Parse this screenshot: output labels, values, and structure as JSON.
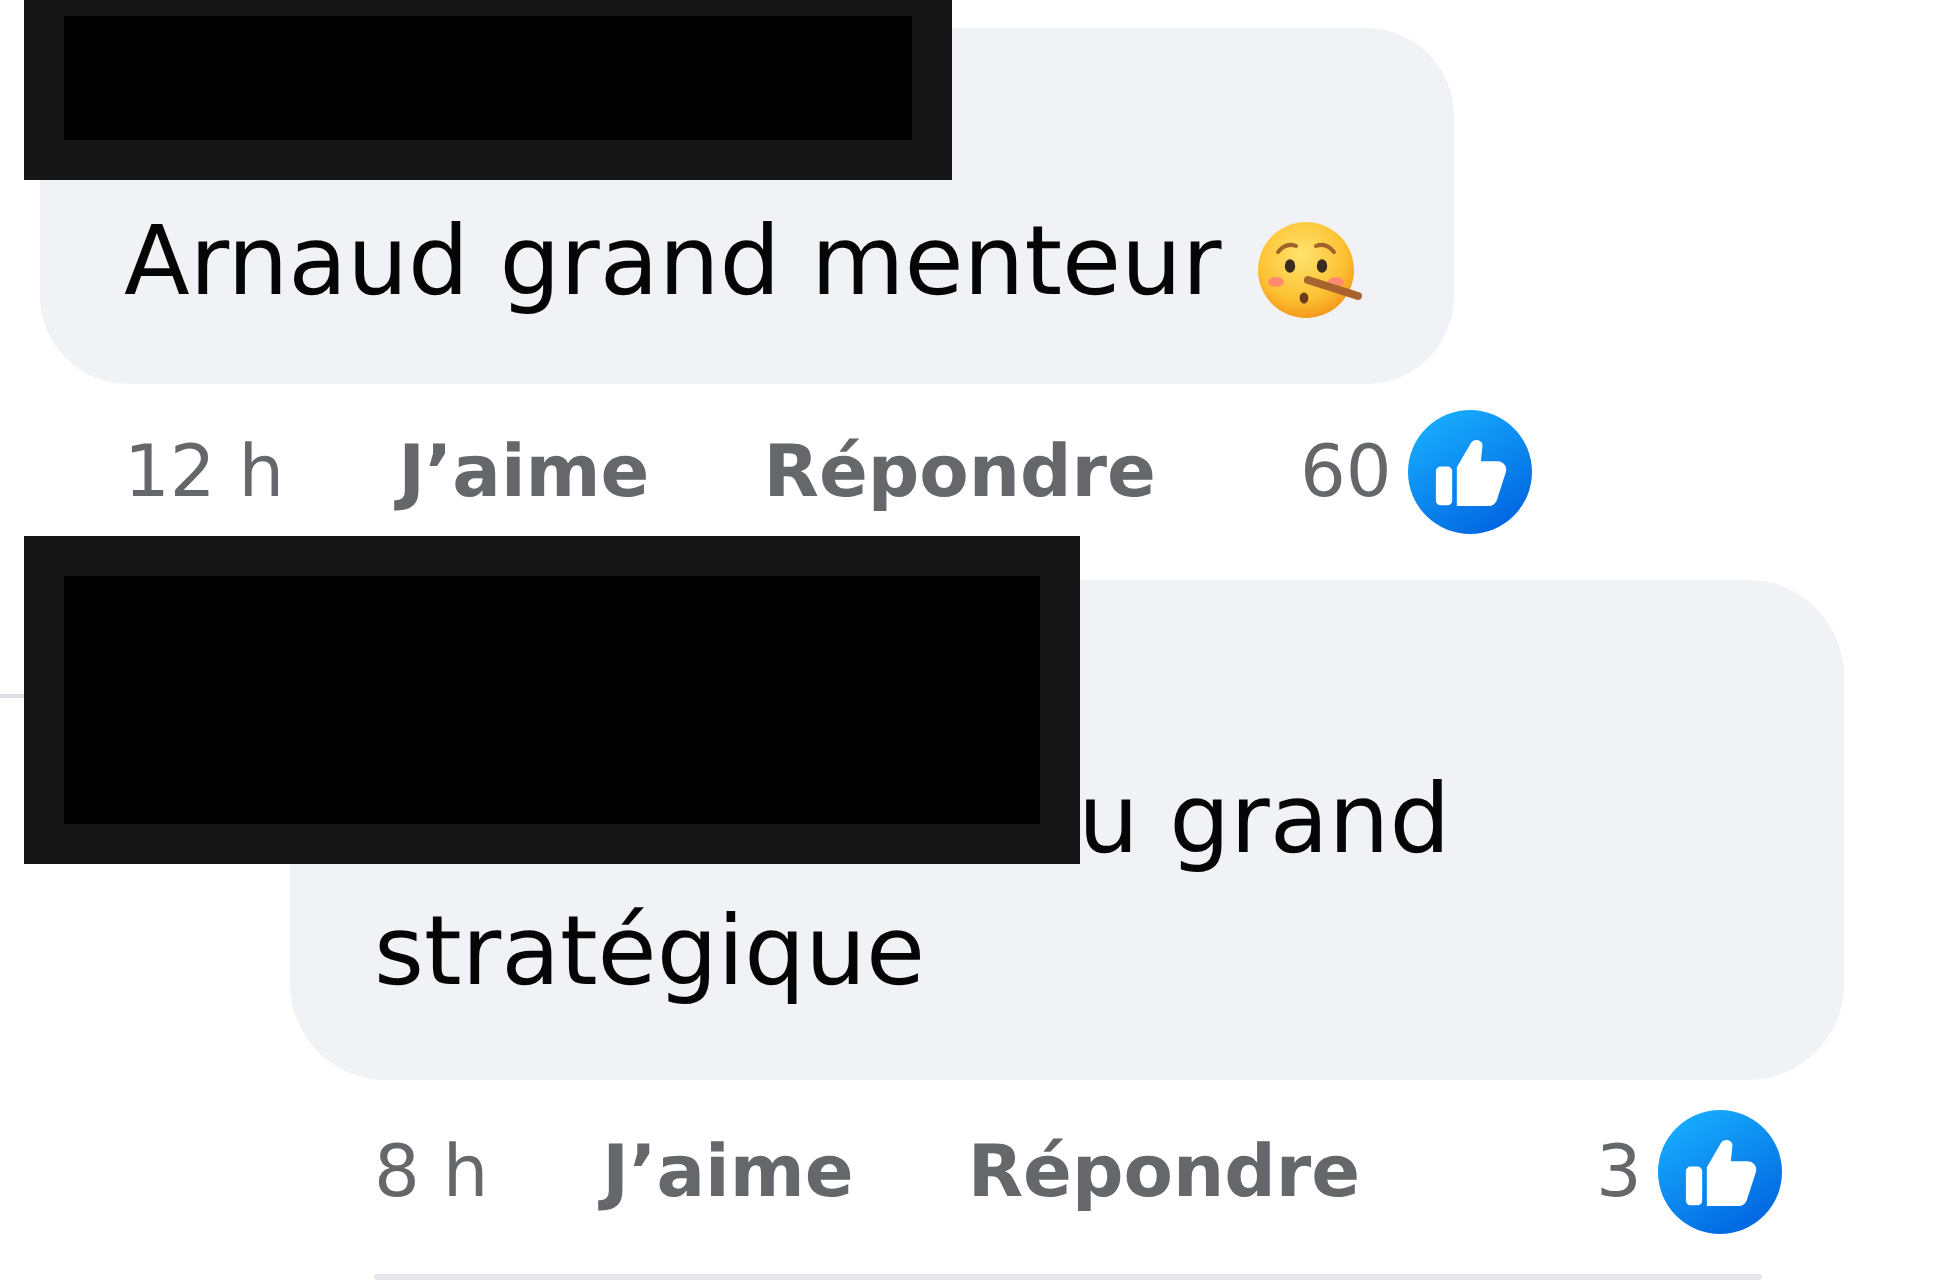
{
  "comments": [
    {
      "author_redacted": true,
      "reply": false,
      "body": "Arnaud grand menteur",
      "emoji": true,
      "time": "12 h",
      "like_label": "J’aime",
      "reply_label": "Répondre",
      "reaction_count": "60"
    },
    {
      "author_redacted": true,
      "reply": true,
      "body": "u grand stratégique",
      "emoji": false,
      "time": "8 h",
      "like_label": "J’aime",
      "reply_label": "Répondre",
      "reaction_count": "3"
    }
  ]
}
